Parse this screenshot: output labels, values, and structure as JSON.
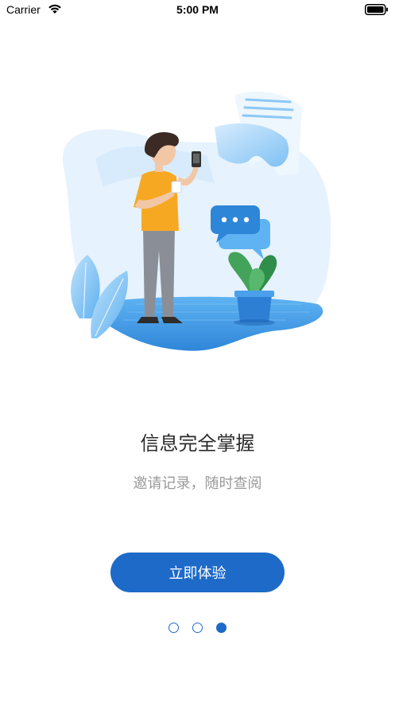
{
  "status_bar": {
    "carrier": "Carrier",
    "time": "5:00 PM"
  },
  "onboarding": {
    "title": "信息完全掌握",
    "subtitle": "邀请记录，随时查阅",
    "cta_label": "立即体验",
    "page_count": 3,
    "current_page": 3
  },
  "colors": {
    "accent": "#1d6ac8",
    "illustration_light": "#e3f1fd",
    "illustration_blue": "#3a9be8",
    "shirt": "#f7a823",
    "plant": "#3ea65a"
  },
  "icons": [
    "wifi-icon",
    "battery-icon",
    "chat-bubble-icon",
    "document-icon",
    "phone-icon",
    "plant-icon",
    "leaf-icon"
  ]
}
